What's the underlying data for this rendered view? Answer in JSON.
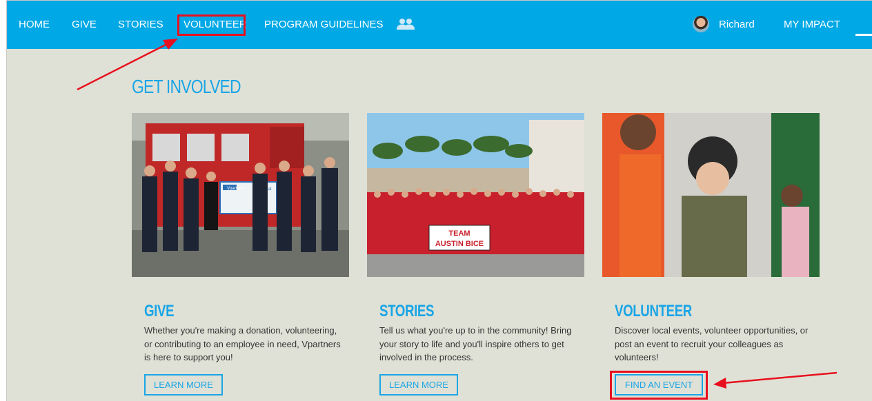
{
  "nav": {
    "items": [
      "HOME",
      "GIVE",
      "STORIES",
      "VOLUNTEER",
      "PROGRAM GUIDELINES"
    ],
    "user_name": "Richard",
    "my_impact": "MY IMPACT"
  },
  "page": {
    "section_title": "GET INVOLVED"
  },
  "cards": [
    {
      "heading": "GIVE",
      "text": "Whether you're making a donation, volunteering, or contributing to an employee in need, Vpartners is here to support you!",
      "button": "LEARN MORE",
      "image": {
        "check_brand": "Vpartners",
        "check_brand2": "ViaSat"
      }
    },
    {
      "heading": "STORIES",
      "text": "Tell us what you're up to in the community! Bring your story to life and you'll inspire others to get involved in the process.",
      "button": "LEARN MORE",
      "image": {
        "banner_line1": "TEAM",
        "banner_line2": "AUSTIN BICE"
      }
    },
    {
      "heading": "VOLUNTEER",
      "text": "Discover local events, volunteer opportunities, or post an event to recruit your colleagues as volunteers!",
      "button": "FIND AN EVENT"
    }
  ],
  "colors": {
    "nav_bg": "#00a8e6",
    "page_bg": "#dfe1d6",
    "accent": "#1aa5e6",
    "annotation": "#e8101e"
  }
}
